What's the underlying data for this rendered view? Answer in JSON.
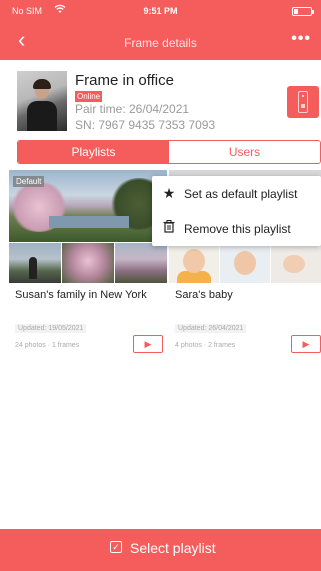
{
  "status_bar": {
    "carrier": "No SIM",
    "wifi_icon": "wifi-icon",
    "time": "9:51 PM",
    "battery_icon": "battery-icon"
  },
  "nav": {
    "back_icon": "chevron-left-icon",
    "title": "Frame details",
    "more_icon": "more-icon"
  },
  "frame": {
    "name": "Frame in office",
    "status": "Online",
    "pair_time": "Pair time: 26/04/2021",
    "serial": "SN: 7967 9435 7353 7093",
    "device_icon": "remote-icon"
  },
  "tabs": [
    {
      "label": "Playlists",
      "active": true
    },
    {
      "label": "Users",
      "active": false
    }
  ],
  "playlists": [
    {
      "title": "Susan's family in New York",
      "badge": "Default",
      "updated": "Updated: 19/05/2021",
      "counts": "24 photos · 1 frames"
    },
    {
      "title": "Sara's baby",
      "badge": "",
      "updated": "Updated: 26/04/2021",
      "counts": "4 photos · 2 frames"
    }
  ],
  "context_menu": {
    "items": [
      {
        "label": "Set as default playlist",
        "icon": "star-icon"
      },
      {
        "label": "Remove this playlist",
        "icon": "trash-icon"
      }
    ]
  },
  "footer": {
    "label": "Select playlist",
    "icon": "checkbox-icon"
  },
  "colors": {
    "accent": "#f55d5d"
  }
}
